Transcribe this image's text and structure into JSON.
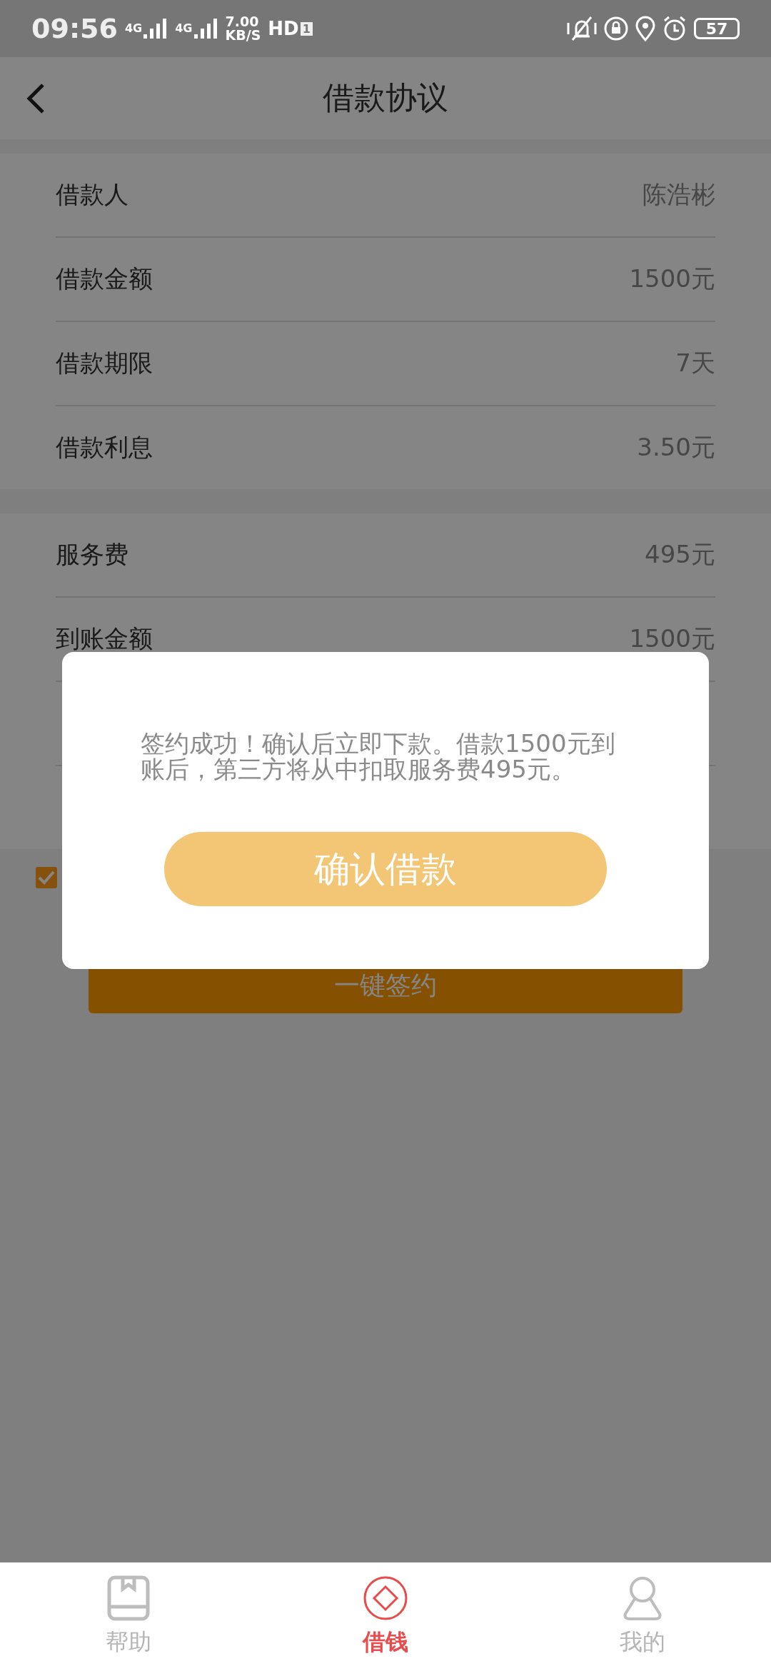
{
  "status_bar": {
    "time": "09:56",
    "sim1": "4G",
    "sim2": "4G",
    "speed": "7.00",
    "speed_unit": "KB/S",
    "hd": "HD",
    "hd_slot": "1",
    "battery": "57"
  },
  "header": {
    "title": "借款协议"
  },
  "sections": [
    {
      "rows": [
        {
          "label": "借款人",
          "value": "陈浩彬"
        },
        {
          "label": "借款金额",
          "value": "1500元"
        },
        {
          "label": "借款期限",
          "value": "7天"
        },
        {
          "label": "借款利息",
          "value": "3.50元"
        }
      ]
    },
    {
      "rows": [
        {
          "label": "服务费",
          "value": "495元"
        },
        {
          "label": "到账金额",
          "value": "1500元"
        }
      ]
    }
  ],
  "agreement": {
    "checked": true
  },
  "sign_button": "一键签约",
  "dialog": {
    "message": "签约成功！确认后立即下款。借款1500元到账后，第三方将从中扣取服务费495元。",
    "button": "确认借款"
  },
  "nav": [
    {
      "kind": "help",
      "label": "帮助",
      "selected": false
    },
    {
      "kind": "borrow",
      "label": "借钱",
      "selected": true
    },
    {
      "kind": "me",
      "label": "我的",
      "selected": false
    }
  ]
}
